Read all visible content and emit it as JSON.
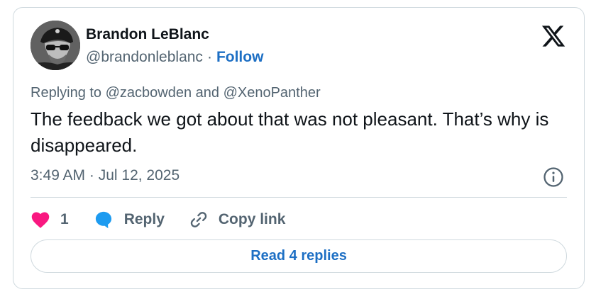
{
  "author": {
    "name": "Brandon LeBlanc",
    "handle": "@brandonleblanc",
    "separator": "·",
    "follow_label": "Follow"
  },
  "platform_icon": "x-logo-icon",
  "reply_context": "Replying to @zacbowden and @XenoPanther",
  "tweet_text": "The feedback we got about that was not pleasant. That’s why is disappeared.",
  "timestamp": "3:49 AM · Jul 12, 2025",
  "actions": {
    "like_count": "1",
    "reply_label": "Reply",
    "copy_link_label": "Copy link"
  },
  "read_replies_label": "Read 4 replies",
  "colors": {
    "like": "#f91880",
    "reply_icon": "#1d9bf0",
    "link": "#1d6fc4",
    "muted": "#536471",
    "border": "#cfd9de"
  }
}
